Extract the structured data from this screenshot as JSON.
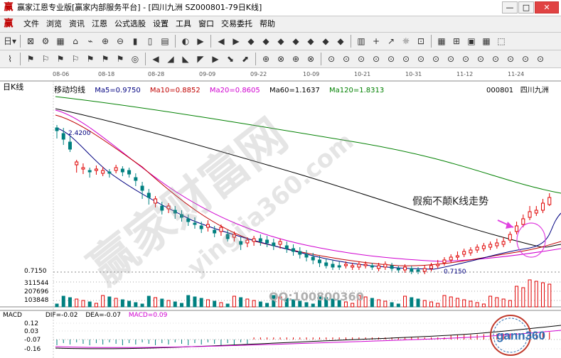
{
  "titlebar": {
    "title": "赢家江恩专业版[赢家内部服务平台] - [四川九洲  SZ000801-79日K线]"
  },
  "menu": {
    "items": [
      "文件",
      "浏览",
      "资讯",
      "江恩",
      "公式选股",
      "设置",
      "工具",
      "窗口",
      "交易委托",
      "帮助"
    ]
  },
  "toolbar": {
    "day_label": "日"
  },
  "axis": {
    "dates": [
      "08-06",
      "08-18",
      "08-28",
      "09-09",
      "09-22",
      "10-09",
      "10-21",
      "10-31",
      "11-12",
      "11-24"
    ]
  },
  "chart": {
    "panel_label": "日K线",
    "ma_title": "移动均线",
    "ma5": "Ma5=0.9750",
    "ma10": "Ma10=0.8852",
    "ma20": "Ma20=0.8605",
    "ma60": "Ma60=1.1637",
    "ma120": "Ma120=1.8313",
    "code": "000801",
    "name": "四川九洲",
    "high_label": "2.4200",
    "low_label": "0.7150",
    "level_label": "0.7150",
    "annotation": "假痴不颠K线走势",
    "colors": {
      "up": "#e00000",
      "down": "#008080",
      "ma5": "#000080",
      "ma10": "#c00000",
      "ma20": "#d000d0",
      "ma60": "#000000",
      "ma120": "#008000"
    }
  },
  "volume": {
    "labels": [
      "311544",
      "207696",
      "103848"
    ]
  },
  "macd": {
    "label": "MACD",
    "dif": "DIF=-0.02",
    "dea": "DEA=-0.07",
    "macd": "MACD=0.09",
    "ticks": [
      "0.12",
      "0.03",
      "-0.07",
      "-0.16"
    ]
  },
  "watermarks": {
    "cn": "赢家财富网",
    "url": "yingjia360.com",
    "qq": "QQ:100800360",
    "logo": "gann360"
  }
}
